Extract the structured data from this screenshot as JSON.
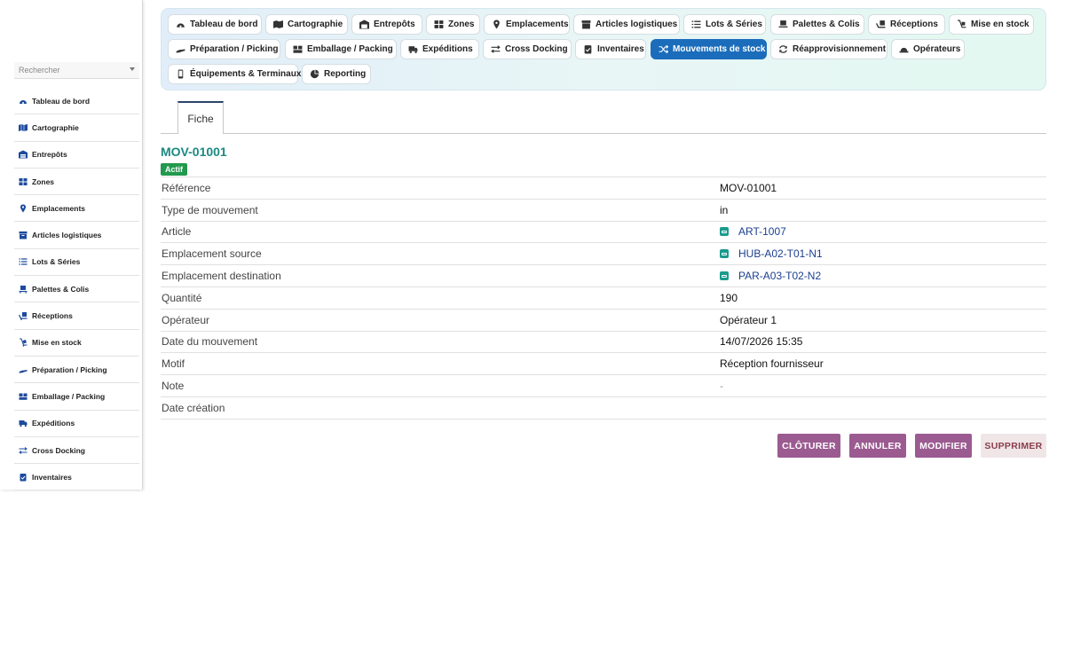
{
  "sidebar": {
    "search_placeholder": "Rechercher",
    "items": [
      {
        "label": "Tableau de bord",
        "icon": "gauge-icon"
      },
      {
        "label": "Cartographie",
        "icon": "map-icon"
      },
      {
        "label": "Entrepôts",
        "icon": "warehouse-icon"
      },
      {
        "label": "Zones",
        "icon": "grid-icon"
      },
      {
        "label": "Emplacements",
        "icon": "map-pin-icon"
      },
      {
        "label": "Articles logistiques",
        "icon": "archive-icon"
      },
      {
        "label": "Lots & Séries",
        "icon": "list-icon"
      },
      {
        "label": "Palettes & Colis",
        "icon": "pallet-icon"
      },
      {
        "label": "Réceptions",
        "icon": "truck-loading-icon"
      },
      {
        "label": "Mise en stock",
        "icon": "dolly-icon"
      },
      {
        "label": "Préparation / Picking",
        "icon": "hand-icon"
      },
      {
        "label": "Emballage / Packing",
        "icon": "boxes-icon"
      },
      {
        "label": "Expéditions",
        "icon": "truck-icon"
      },
      {
        "label": "Cross Docking",
        "icon": "arrows-exchange-icon"
      },
      {
        "label": "Inventaires",
        "icon": "clipboard-check-icon"
      }
    ]
  },
  "nav": {
    "items": [
      {
        "label": "Tableau de bord"
      },
      {
        "label": "Cartographie"
      },
      {
        "label": "Entrepôts"
      },
      {
        "label": "Zones"
      },
      {
        "label": "Emplacements"
      },
      {
        "label": "Articles logistiques"
      },
      {
        "label": "Lots & Séries"
      },
      {
        "label": "Palettes & Colis"
      },
      {
        "label": "Réceptions"
      },
      {
        "label": "Mise en stock"
      },
      {
        "label": "Préparation / Picking"
      },
      {
        "label": "Emballage / Packing"
      },
      {
        "label": "Expéditions"
      },
      {
        "label": "Cross Docking"
      },
      {
        "label": "Inventaires"
      },
      {
        "label": "Mouvements de stock"
      },
      {
        "label": "Réapprovisionnement"
      },
      {
        "label": "Opérateurs"
      },
      {
        "label": "Équipements & Terminaux"
      },
      {
        "label": "Reporting"
      }
    ],
    "active": "Mouvements de stock",
    "active_color": "#1b6dbb"
  },
  "tabs": {
    "fiche": "Fiche"
  },
  "record": {
    "title": "MOV-01001",
    "status": "Actif",
    "fields": [
      {
        "label": "Référence",
        "value": "MOV-01001"
      },
      {
        "label": "Type de mouvement",
        "value": "in"
      },
      {
        "label": "Article",
        "value": "ART-1007"
      },
      {
        "label": "Emplacement source",
        "value": "HUB-A02-T01-N1"
      },
      {
        "label": "Emplacement destination",
        "value": "PAR-A03-T02-N2"
      },
      {
        "label": "Quantité",
        "value": "190"
      },
      {
        "label": "Opérateur",
        "value": "Opérateur 1"
      },
      {
        "label": "Date du mouvement",
        "value": "14/07/2026 15:35"
      },
      {
        "label": "Motif",
        "value": "Réception fournisseur"
      },
      {
        "label": "Note",
        "value": "-"
      },
      {
        "label": "Date création",
        "value": ""
      }
    ]
  },
  "actions": {
    "cloturer": "CLÔTURER",
    "annuler": "ANNULER",
    "modifier": "MODIFIER",
    "supprimer": "SUPPRIMER"
  },
  "colors": {
    "title_teal": "#1a8a82",
    "badge_green": "#22994d",
    "button_purple": "#9b5b91",
    "link_blue": "#1b3f8f"
  }
}
